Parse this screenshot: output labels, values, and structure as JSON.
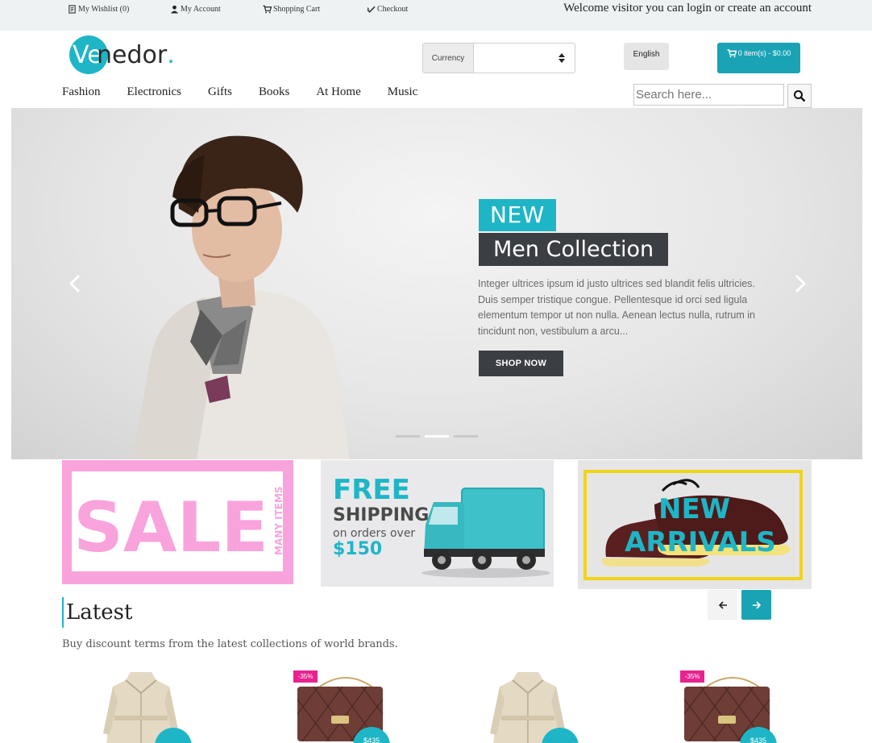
{
  "topbar": {
    "wishlist": "My Wishlist (0)",
    "account": "My Account",
    "cart": "Shopping Cart",
    "checkout": "Checkout",
    "welcome": "Welcome visitor you can login or create an account"
  },
  "brand": {
    "logo_ve": "Ve",
    "logo_rest": "nedor",
    "logo_dot": "."
  },
  "header": {
    "currency_label": "Currency",
    "currency_value": "",
    "language": "English",
    "cart_summary": "0 item(s) - $0.00"
  },
  "nav": {
    "items": [
      "Fashion",
      "Electronics",
      "Gifts",
      "Books",
      "At Home",
      "Music"
    ]
  },
  "search": {
    "placeholder": "Search here..."
  },
  "hero": {
    "tag_new": "NEW",
    "tag_collection": "Men Collection",
    "text": "Integer ultrices ipsum id justo ultrices sed blandit felis ultricies. Duis semper tristique congue. Pellentesque id orci sed ligula elementum tempor ut non nulla. Aenean lectus nulla, rutrum in tincidunt non, vestibulum a arcu...",
    "cta": "SHOP NOW",
    "active_slide": 2,
    "slide_count": 3
  },
  "banners": {
    "sale": {
      "big": "SALE",
      "side": "MANY ITEMS"
    },
    "shipping": {
      "line1": "FREE",
      "line2": "SHIPPING",
      "line3": "on orders over",
      "line4": "$150"
    },
    "arrivals": {
      "line1": "NEW",
      "line2": "ARRIVALS"
    }
  },
  "latest": {
    "title": "Latest",
    "subtitle": "Buy discount terms from the latest collections of world brands."
  },
  "products": [
    {
      "type": "coat",
      "discount": "",
      "price": ""
    },
    {
      "type": "bag",
      "discount": "-35%",
      "price": "$435"
    },
    {
      "type": "coat",
      "discount": "",
      "price": ""
    },
    {
      "type": "bag",
      "discount": "-35%",
      "price": "$435"
    }
  ],
  "colors": {
    "accent": "#1eb6c6",
    "accent_dark": "#1aa3b4",
    "dark_tag": "#3b3f44",
    "sale_pink": "#f9a3dc",
    "discount_magenta": "#e8238f"
  }
}
